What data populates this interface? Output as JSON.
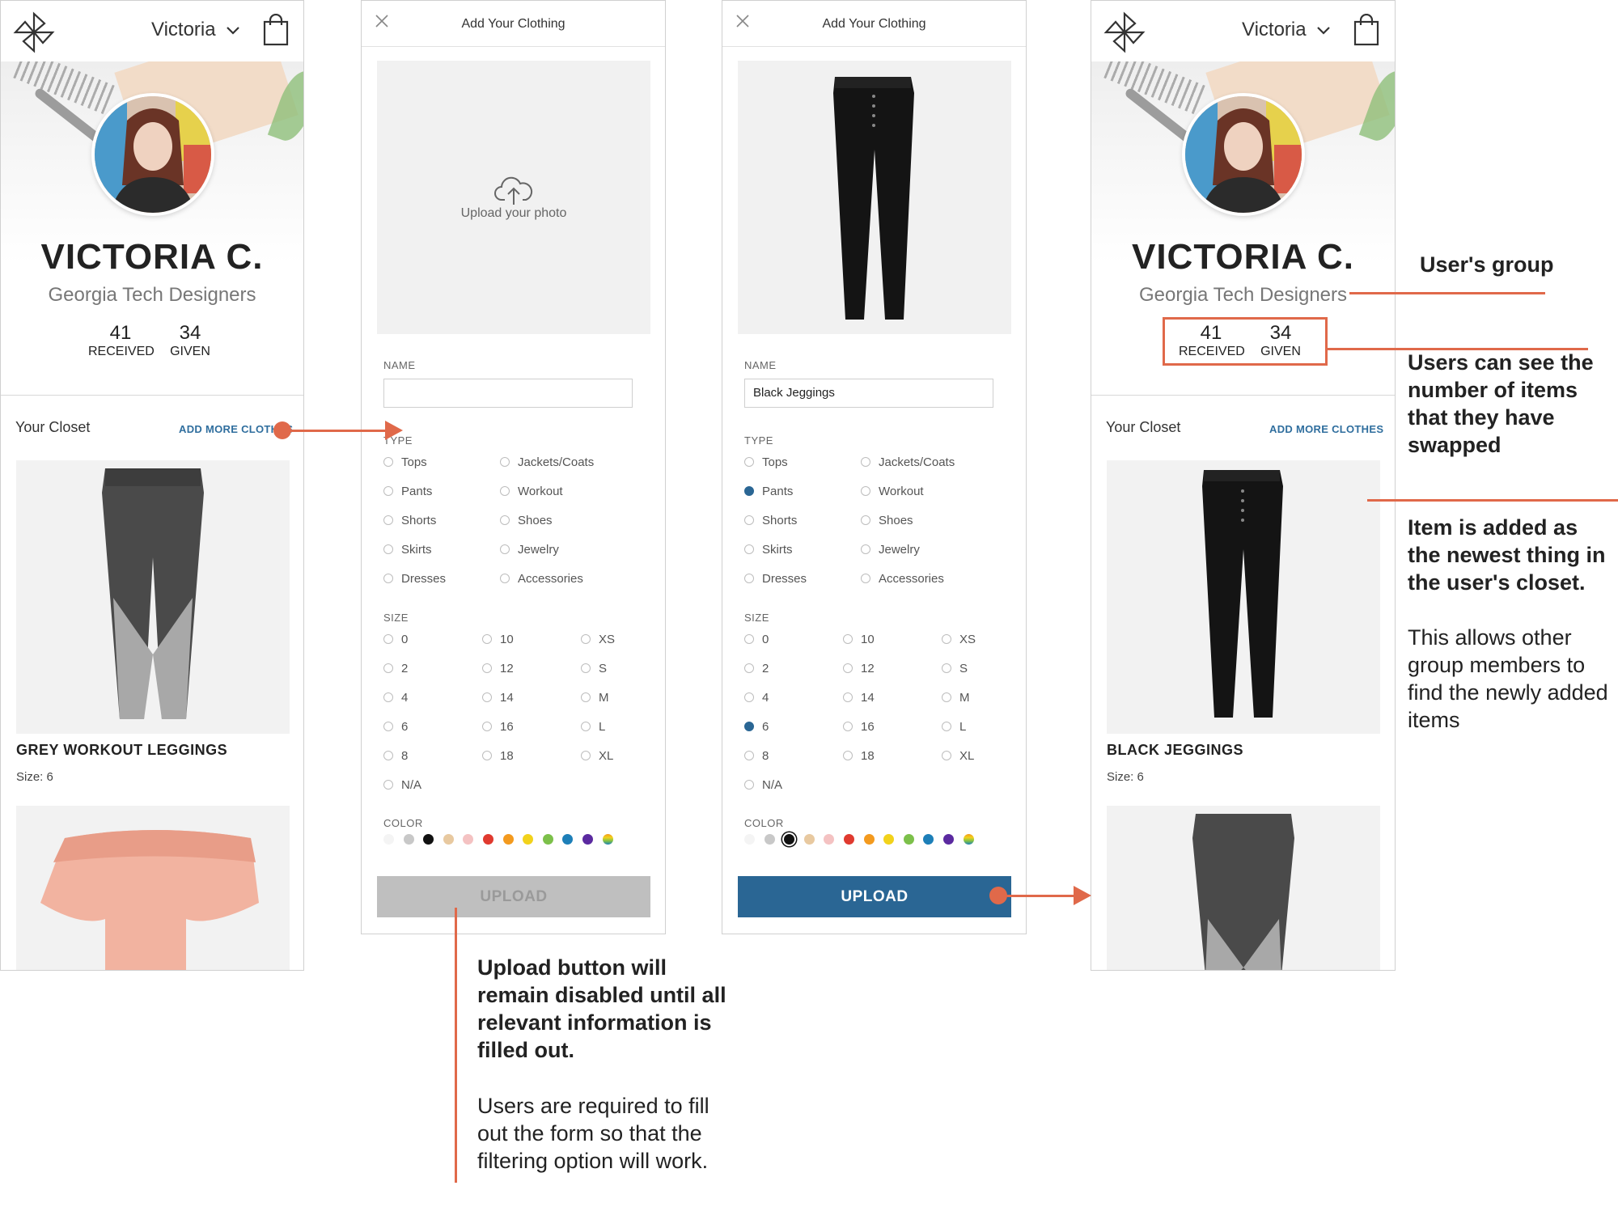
{
  "screen1": {
    "user_name": "Victoria",
    "profile_name": "VICTORIA C.",
    "group": "Georgia Tech Designers",
    "received_count": "41",
    "received_label": "RECEIVED",
    "given_count": "34",
    "given_label": "GIVEN",
    "closet_title": "Your Closet",
    "add_more": "ADD MORE CLOTHES",
    "item1_name": "GREY WORKOUT LEGGINGS",
    "item1_size": "Size: 6"
  },
  "screen2": {
    "title": "Add Your Clothing",
    "upload_photo": "Upload your photo",
    "name_label": "NAME",
    "name_value": "",
    "type_label": "TYPE",
    "types_left": [
      "Tops",
      "Pants",
      "Shorts",
      "Skirts",
      "Dresses"
    ],
    "types_right": [
      "Jackets/Coats",
      "Workout",
      "Shoes",
      "Jewelry",
      "Accessories"
    ],
    "size_label": "SIZE",
    "sizes_col1": [
      "0",
      "2",
      "4",
      "6",
      "8",
      "N/A"
    ],
    "sizes_col2": [
      "10",
      "12",
      "14",
      "16",
      "18"
    ],
    "sizes_col3": [
      "XS",
      "S",
      "M",
      "L",
      "XL"
    ],
    "color_label": "COLOR",
    "upload_button": "UPLOAD"
  },
  "screen3": {
    "title": "Add Your Clothing",
    "name_label": "NAME",
    "name_value": "Black Jeggings",
    "type_label": "TYPE",
    "types_left": [
      "Tops",
      "Pants",
      "Shorts",
      "Skirts",
      "Dresses"
    ],
    "types_right": [
      "Jackets/Coats",
      "Workout",
      "Shoes",
      "Jewelry",
      "Accessories"
    ],
    "selected_type": "Pants",
    "size_label": "SIZE",
    "sizes_col1": [
      "0",
      "2",
      "4",
      "6",
      "8",
      "N/A"
    ],
    "sizes_col2": [
      "10",
      "12",
      "14",
      "16",
      "18"
    ],
    "sizes_col3": [
      "XS",
      "S",
      "M",
      "L",
      "XL"
    ],
    "selected_size": "6",
    "color_label": "COLOR",
    "selected_color": "#111111",
    "upload_button": "UPLOAD"
  },
  "screen4": {
    "user_name": "Victoria",
    "profile_name": "VICTORIA C.",
    "group": "Georgia Tech Designers",
    "received_count": "41",
    "received_label": "RECEIVED",
    "given_count": "34",
    "given_label": "GIVEN",
    "closet_title": "Your Closet",
    "add_more": "ADD MORE CLOTHES",
    "item1_name": "BLACK JEGGINGS",
    "item1_size": "Size: 6"
  },
  "colors": [
    "#f4f4f4",
    "#c8c8c8",
    "#111111",
    "#e8c9a0",
    "#f4c2c2",
    "#e03a2f",
    "#f39a1e",
    "#f2d21b",
    "#7cc04a",
    "#1d7fb8",
    "#5b2aa0",
    "rainbow"
  ],
  "accent": "#e0694a",
  "brand_blue": "#2a6694",
  "annotations": {
    "users_group": "User's group",
    "swap_count": "Users can see the number of items that they have swapped",
    "added_bold": "Item is added as the newest thing in the user's closet.",
    "added_normal": "This allows other group members to find the newly added items",
    "upload_bold": "Upload button will remain disabled until all relevant information is filled out.",
    "upload_normal": "Users are required to fill out the form so that the filtering option will work."
  }
}
